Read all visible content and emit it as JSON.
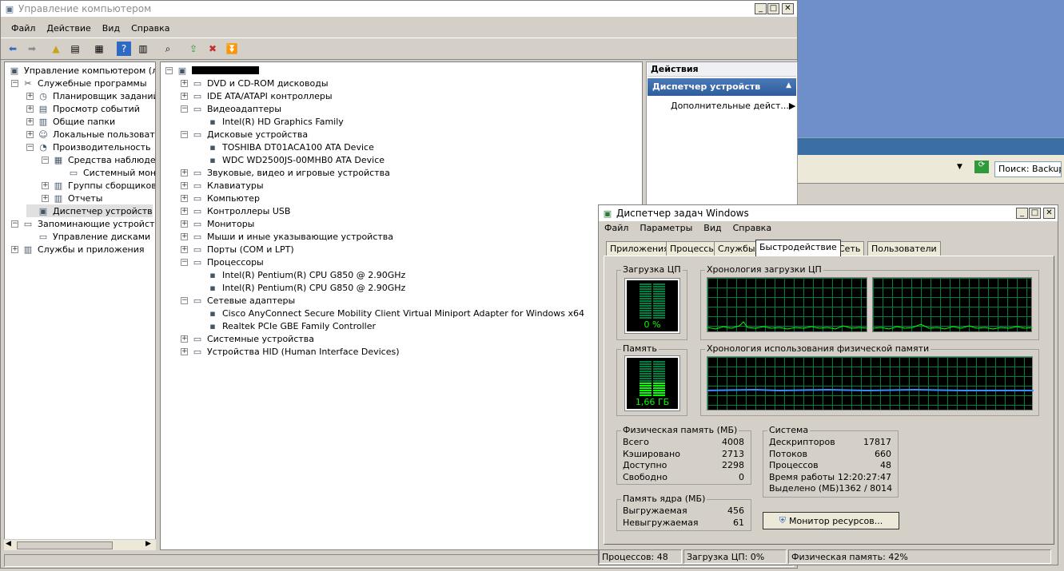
{
  "cm": {
    "title": "Управление компьютером",
    "menu": [
      "Файл",
      "Действие",
      "Вид",
      "Справка"
    ],
    "tree": [
      {
        "label": "Управление компьютером (лока",
        "level": 0,
        "exp": ""
      },
      {
        "label": "Служебные программы",
        "level": 1,
        "exp": "−"
      },
      {
        "label": "Планировщик заданий",
        "level": 2,
        "exp": "+"
      },
      {
        "label": "Просмотр событий",
        "level": 2,
        "exp": "+"
      },
      {
        "label": "Общие папки",
        "level": 2,
        "exp": "+"
      },
      {
        "label": "Локальные пользовател",
        "level": 2,
        "exp": "+"
      },
      {
        "label": "Производительность",
        "level": 2,
        "exp": "−"
      },
      {
        "label": "Средства наблюде",
        "level": 3,
        "exp": "−"
      },
      {
        "label": "Системный мони",
        "level": 4,
        "exp": ""
      },
      {
        "label": "Группы сборщиков д",
        "level": 3,
        "exp": "+"
      },
      {
        "label": "Отчеты",
        "level": 3,
        "exp": "+"
      },
      {
        "label": "Диспетчер устройств",
        "level": 2,
        "exp": "",
        "selected": true
      },
      {
        "label": "Запоминающие устройства",
        "level": 1,
        "exp": "−"
      },
      {
        "label": "Управление дисками",
        "level": 2,
        "exp": ""
      },
      {
        "label": "Службы и приложения",
        "level": 1,
        "exp": "+"
      }
    ],
    "devices": [
      {
        "label": "",
        "level": 0,
        "exp": "−",
        "redacted": true
      },
      {
        "label": "DVD и CD-ROM дисководы",
        "level": 1,
        "exp": "+"
      },
      {
        "label": "IDE ATA/ATAPI контроллеры",
        "level": 1,
        "exp": "+"
      },
      {
        "label": "Видеоадаптеры",
        "level": 1,
        "exp": "−"
      },
      {
        "label": "Intel(R) HD Graphics Family",
        "level": 2,
        "exp": ""
      },
      {
        "label": "Дисковые устройства",
        "level": 1,
        "exp": "−"
      },
      {
        "label": "TOSHIBA DT01ACA100 ATA Device",
        "level": 2,
        "exp": ""
      },
      {
        "label": "WDC WD2500JS-00MHB0 ATA Device",
        "level": 2,
        "exp": ""
      },
      {
        "label": "Звуковые, видео и игровые устройства",
        "level": 1,
        "exp": "+"
      },
      {
        "label": "Клавиатуры",
        "level": 1,
        "exp": "+"
      },
      {
        "label": "Компьютер",
        "level": 1,
        "exp": "+"
      },
      {
        "label": "Контроллеры USB",
        "level": 1,
        "exp": "+"
      },
      {
        "label": "Мониторы",
        "level": 1,
        "exp": "+"
      },
      {
        "label": "Мыши и иные указывающие устройства",
        "level": 1,
        "exp": "+"
      },
      {
        "label": "Порты (COM и LPT)",
        "level": 1,
        "exp": "+"
      },
      {
        "label": "Процессоры",
        "level": 1,
        "exp": "−"
      },
      {
        "label": "Intel(R) Pentium(R) CPU G850 @ 2.90GHz",
        "level": 2,
        "exp": ""
      },
      {
        "label": "Intel(R) Pentium(R) CPU G850 @ 2.90GHz",
        "level": 2,
        "exp": ""
      },
      {
        "label": "Сетевые адаптеры",
        "level": 1,
        "exp": "−"
      },
      {
        "label": "Cisco AnyConnect Secure Mobility Client Virtual Miniport Adapter for Windows x64",
        "level": 2,
        "exp": ""
      },
      {
        "label": "Realtek PCIe GBE Family Controller",
        "level": 2,
        "exp": ""
      },
      {
        "label": "Системные устройства",
        "level": 1,
        "exp": "+"
      },
      {
        "label": "Устройства HID (Human Interface Devices)",
        "level": 1,
        "exp": "+"
      }
    ],
    "actions": {
      "header": "Действия",
      "selected": "Диспетчер устройств",
      "more": "Дополнительные дейст..."
    }
  },
  "bg": {
    "search": "Поиск: Backup"
  },
  "tm": {
    "title": "Диспетчер задач Windows",
    "menu": [
      "Файл",
      "Параметры",
      "Вид",
      "Справка"
    ],
    "tabs": [
      "Приложения",
      "Процессы",
      "Службы",
      "Быстродействие",
      "Сеть",
      "Пользователи"
    ],
    "selected_tab": "Быстродействие",
    "cpu_label": "Загрузка ЦП",
    "cpu_value": "0 %",
    "cpu_level": 0.02,
    "cpu_hist_label": "Хронология загрузки ЦП",
    "mem_label": "Память",
    "mem_value": "1,66 ГБ",
    "mem_level": 0.42,
    "mem_hist_label": "Хронология использования физической памяти",
    "phys": {
      "label": "Физическая память (МБ)",
      "rows": [
        {
          "k": "Всего",
          "v": "4008"
        },
        {
          "k": "Кэшировано",
          "v": "2713"
        },
        {
          "k": "Доступно",
          "v": "2298"
        },
        {
          "k": "Свободно",
          "v": "0"
        }
      ]
    },
    "kernel": {
      "label": "Память ядра (МБ)",
      "rows": [
        {
          "k": "Выгружаемая",
          "v": "456"
        },
        {
          "k": "Невыгружаемая",
          "v": "61"
        }
      ]
    },
    "system": {
      "label": "Система",
      "rows": [
        {
          "k": "Дескрипторов",
          "v": "17817"
        },
        {
          "k": "Потоков",
          "v": "660"
        },
        {
          "k": "Процессов",
          "v": "48"
        },
        {
          "k": "Время работы",
          "v": "12:20:27:47"
        },
        {
          "k": "Выделено (МБ)",
          "v": "1362 / 8014"
        }
      ]
    },
    "resmon": "Монитор ресурсов...",
    "status": [
      "Процессов: 48",
      "Загрузка ЦП: 0%",
      "Физическая память: 42%"
    ]
  }
}
